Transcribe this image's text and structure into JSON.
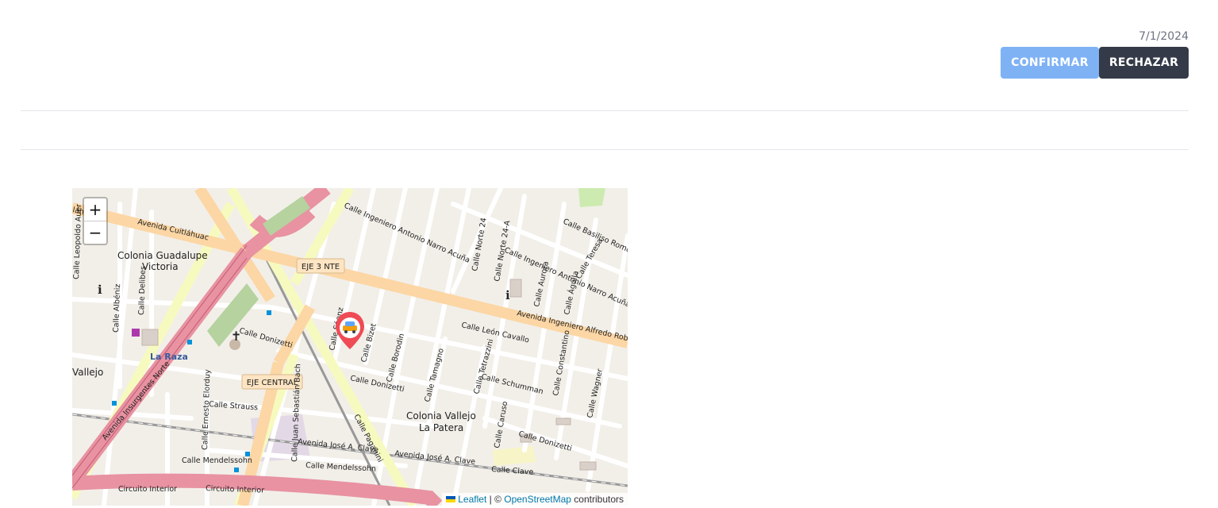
{
  "header": {
    "date": "7/1/2024"
  },
  "actions": {
    "confirm_label": "CONFIRMAR",
    "reject_label": "RECHAZAR"
  },
  "map": {
    "zoom_in": "+",
    "zoom_out": "−",
    "attribution": {
      "leaflet": "Leaflet",
      "separator": " | © ",
      "osm": "OpenStreetMap",
      "suffix": " contributors"
    },
    "labels": {
      "cuitlahuac": "Avenida Cuitláhuac",
      "huahua": "láhua",
      "guadalupe1": "Colonia Guadalupe",
      "guadalupe2": "Victoria",
      "eje3": "EJE 3 NTE",
      "ejecentral": "EJE CENTRAL",
      "narro1": "Calle Ingeniero Antonio Narro Acuña",
      "narro2": "Calle Ingeniero Antonio Narro Acuña",
      "alfredo": "Avenida Ingeniero Alfredo Robles",
      "basilio": "Calle Basiliso Romo A",
      "norte24": "Calle Norte 24",
      "norte24a": "Calle Norte 24-A",
      "aurora": "Calle Aurora",
      "aguila": "Calle Águila",
      "teresa": "Calle Teresa",
      "leoncavallo": "Calle León Cavallo",
      "donizetti1": "Calle Donizetti",
      "donizetti2": "Calle Donizetti",
      "donizetti3": "Calle Donizetti",
      "schumman": "Calle Schumman",
      "borodin": "Calle Borodin",
      "bizet": "Calle Bizet",
      "saenz": "Calle Sáenz",
      "tamagno": "Calle Tamagno",
      "tetrazzini": "Calle Tetrazzini",
      "constantino": "Calle Constantino",
      "wagner": "Calle Wagner",
      "caruso": "Calle Caruso",
      "vallejo1": "Colonia Vallejo",
      "vallejo2": "La Patera",
      "vallejoleft": "Vallejo",
      "strauss": "Calle Strauss",
      "elorduy": "Calle Ernesto Elorduy",
      "bach": "Calle Juan Sebastián Bach",
      "clave1": "Avenida José A. Clave",
      "clave2": "Avenida José A. Clave",
      "clave3": "Calle Clave",
      "mendelssohn1": "Calle Mendelssohn",
      "mendelssohn2": "Calle Mendelssohn",
      "paganini": "Calle Paganini",
      "circuito1": "Circuito Interior",
      "circuito2": "Circuito Interior",
      "insurgentes": "Avenida Insurgentes Norte",
      "laraza": "La Raza",
      "albeniz": "Calle Albéniz",
      "delibes": "Calle Delibes",
      "leopoldo": "Calle Leopoldo Auer"
    }
  }
}
